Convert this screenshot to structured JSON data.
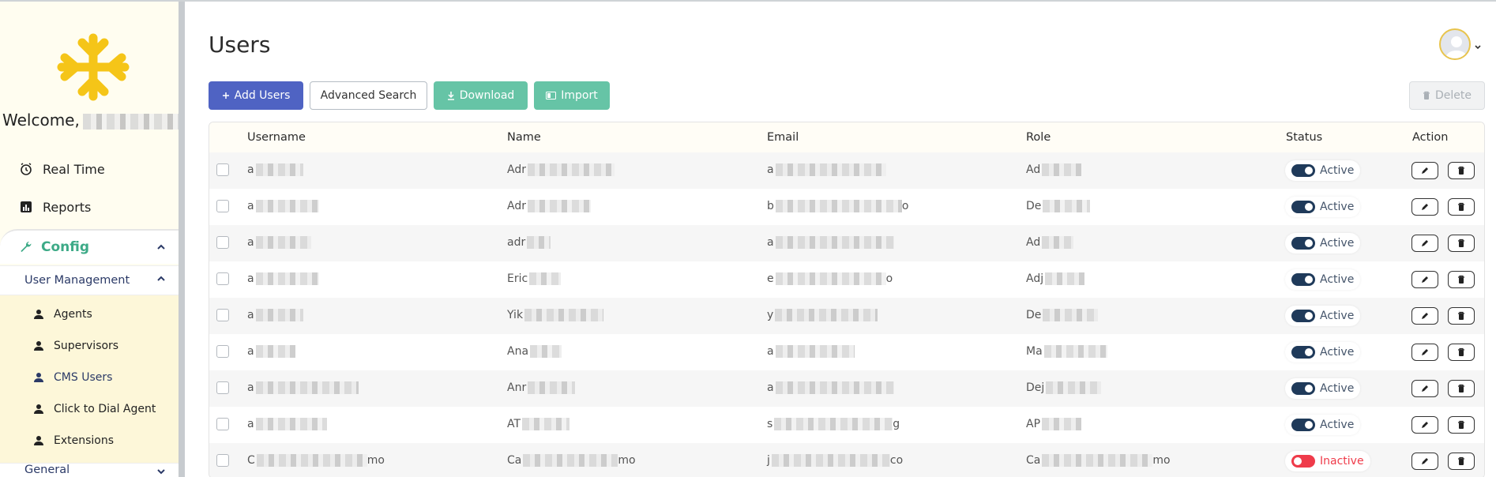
{
  "sidebar": {
    "welcome_text": "Welcome,",
    "nav": [
      {
        "label": "Real Time",
        "icon": "alarm-clock-icon"
      },
      {
        "label": "Reports",
        "icon": "bar-chart-icon"
      }
    ],
    "config": {
      "label": "Config",
      "icon": "wrench-icon",
      "color": "#3daa87"
    },
    "user_management": {
      "label": "User Management",
      "items": [
        {
          "label": "Agents",
          "icon": "person-icon"
        },
        {
          "label": "Supervisors",
          "icon": "person-icon"
        },
        {
          "label": "CMS Users",
          "icon": "person-icon",
          "active": true
        },
        {
          "label": "Click to Dial Agent",
          "icon": "person-icon"
        },
        {
          "label": "Extensions",
          "icon": "person-icon"
        }
      ]
    },
    "general": {
      "label": "General"
    }
  },
  "header": {
    "title": "Users"
  },
  "toolbar": {
    "add_label": "Add Users",
    "advanced_label": "Advanced Search",
    "download_label": "Download",
    "import_label": "Import",
    "delete_label": "Delete"
  },
  "colors": {
    "primary": "#4f63c3",
    "green": "#66c4a6",
    "active_toggle": "#1f3a5a",
    "inactive_toggle": "#ef3b4a",
    "logo_yellow": "#f5c518"
  },
  "table": {
    "columns": [
      "Username",
      "Name",
      "Email",
      "Role",
      "Status",
      "Action"
    ],
    "rows": [
      {
        "username": "a",
        "name": "Adr",
        "email": "a",
        "role": "Ad",
        "status": "Active"
      },
      {
        "username": "a",
        "name": "Adr",
        "email": "b",
        "email_tail": "o",
        "role": "De",
        "status": "Active"
      },
      {
        "username": "a",
        "name": "adr",
        "email": "a",
        "role": "Ad",
        "status": "Active"
      },
      {
        "username": "a",
        "name": "Eric",
        "email": "e",
        "email_tail": "o",
        "role": "Adj",
        "status": "Active"
      },
      {
        "username": "a",
        "name": "Yik",
        "email": "y",
        "role": "De",
        "status": "Active"
      },
      {
        "username": "a",
        "name": "Ana",
        "email": "a",
        "role": "Ma",
        "status": "Active"
      },
      {
        "username": "a",
        "name": "Anr",
        "email": "a",
        "role": "Dej",
        "status": "Active"
      },
      {
        "username": "a",
        "name": "AT",
        "email": "s",
        "email_tail": "g",
        "role": "AP",
        "status": "Active"
      },
      {
        "username": "C",
        "username_tail": "mo",
        "name": "Ca",
        "name_tail": "mo",
        "email": "j",
        "email_tail": "co",
        "role": "Ca",
        "role_tail": "mo",
        "status": "Inactive"
      }
    ]
  }
}
